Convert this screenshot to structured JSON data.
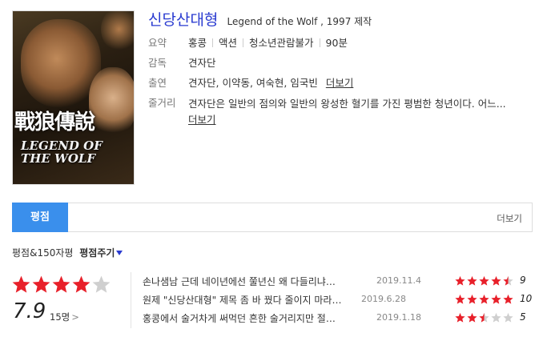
{
  "movie": {
    "title": "신당산대형",
    "subtitle": "Legend of the Wolf , 1997 제작",
    "poster_text_cn": "戰狼傳說",
    "poster_text_en": "LEGEND OF\nTHE WOLF"
  },
  "info": {
    "summary_label": "요약",
    "summary_items": [
      "홍콩",
      "액션",
      "청소년관람불가",
      "90분"
    ],
    "director_label": "감독",
    "director": "견자단",
    "cast_label": "출연",
    "cast": "견자단, 이약동, 여숙현, 임국빈",
    "cast_more": "더보기",
    "plot_label": "줄거리",
    "plot": "견자단은 일반의 점의와 일반의 왕성한 혈기를 가진 평범한 청년이다. 어느...",
    "plot_more": "더보기"
  },
  "tabs": {
    "active": "평점",
    "more": "더보기"
  },
  "rating": {
    "heading": "평점&150자평",
    "give": "평점주기",
    "score": "7.9",
    "count": "15명",
    "chevron": ">",
    "stars_filled": 4,
    "stars_total": 5,
    "colors": {
      "star_on": "#e8202a",
      "star_off": "#cfcfcf",
      "title": "#2a3bd0",
      "tab": "#3a8fec"
    }
  },
  "reviews": [
    {
      "text": "손나샘남 근데 네이년에선 쭐년신 왜 다들리냐…",
      "date": "2019.11.4",
      "score": "9",
      "score_value": 9
    },
    {
      "text": "원제 \"신당산대형\" 제목 좀 바 꿨다 줄이지 마라…",
      "date": "2019.6.28",
      "score": "10",
      "score_value": 10
    },
    {
      "text": "홍콩에서 술거차게 써먹던 흔한 술거리지만 절…",
      "date": "2019.1.18",
      "score": "5",
      "score_value": 5
    }
  ]
}
